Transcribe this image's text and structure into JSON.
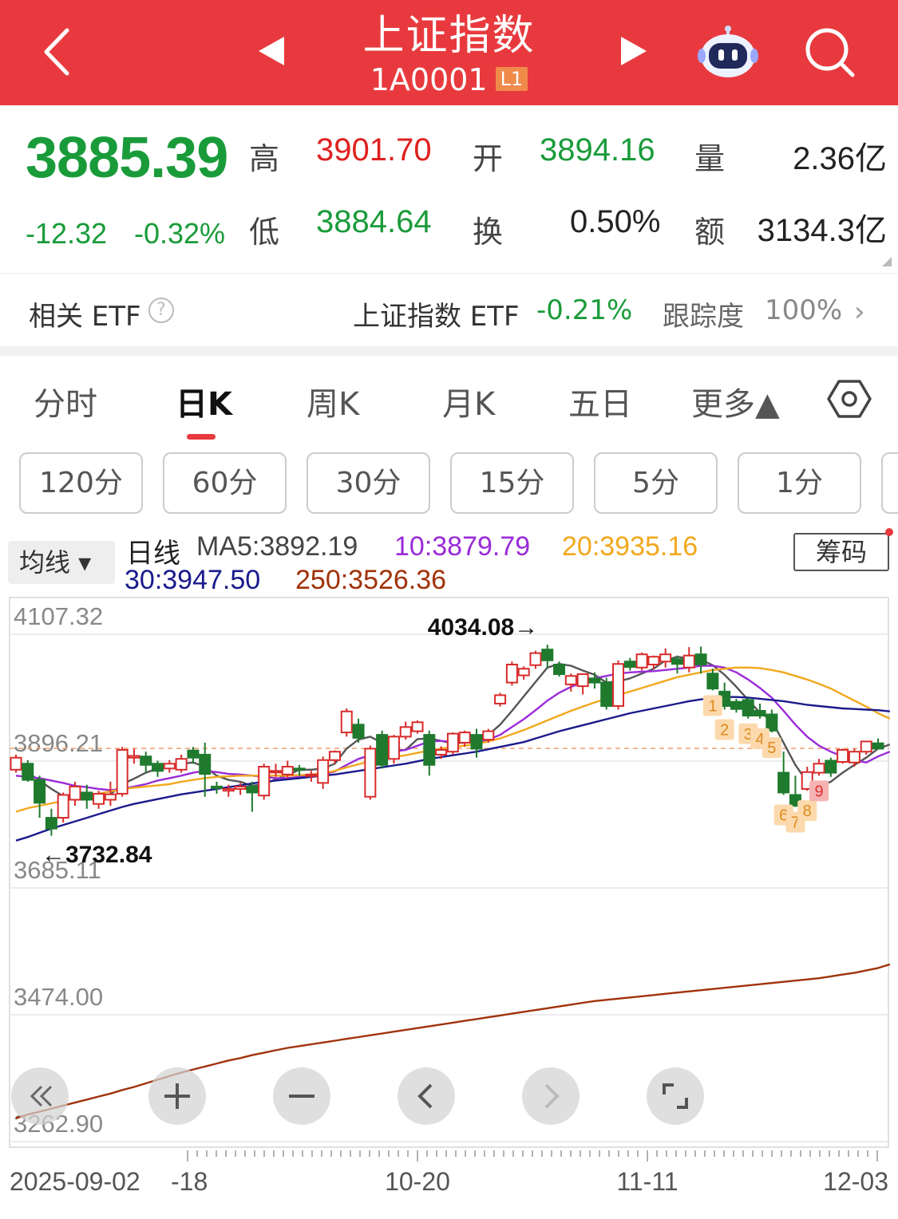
{
  "header": {
    "title": "上证指数",
    "code": "1A0001",
    "badge": "L1",
    "icons": [
      "back-arrow-icon",
      "prev-stock-icon",
      "next-stock-icon",
      "robot-assistant-icon",
      "search-icon"
    ]
  },
  "quote": {
    "price": "3885.39",
    "change": "-12.32",
    "change_pct": "-0.32%",
    "high_label": "高",
    "high": "3901.70",
    "open_label": "开",
    "open": "3894.16",
    "volume_label": "量",
    "volume": "2.36亿",
    "low_label": "低",
    "low": "3884.64",
    "turnover_label": "换",
    "turnover": "0.50%",
    "amount_label": "额",
    "amount": "3134.3亿",
    "colors": {
      "up": "#e02020",
      "down": "#1a9b3a"
    }
  },
  "etf": {
    "label": "相关 ETF",
    "help": "?",
    "name": "上证指数 ETF",
    "pct": "-0.21%",
    "track_label": "跟踪度",
    "track_value": "100%",
    "arrow": "›"
  },
  "tabs": {
    "items": [
      "分时",
      "日K",
      "周K",
      "月K",
      "五日",
      "更多▲"
    ],
    "active": "日K"
  },
  "periods": [
    "120分",
    "60分",
    "30分",
    "15分",
    "5分",
    "1分"
  ],
  "chart_header": {
    "ma_button": "均线 ▾",
    "line_label": "日线",
    "ma5": "MA5:3892.19",
    "ma10": "10:3879.79",
    "ma20": "20:3935.16",
    "ma30": "30:3947.50",
    "ma250": "250:3526.36",
    "chip_button": "筹码"
  },
  "chart_data": {
    "type": "candlestick",
    "y_ticks": [
      "4107.32",
      "3896.21",
      "3685.11",
      "3474.00",
      "3262.90"
    ],
    "ylim": [
      3262.9,
      4107.32
    ],
    "x_ticks": [
      "2025-09-02",
      "-18",
      "10-20",
      "11-11",
      "12-03"
    ],
    "annotations": {
      "max": "4034.08→",
      "min": "←3732.84"
    },
    "reference_price": 3885.39,
    "candles": [
      [
        3850,
        3870,
        3845,
        3875
      ],
      [
        3860,
        3833,
        3830,
        3866
      ],
      [
        3833,
        3795,
        3770,
        3840
      ],
      [
        3770,
        3752,
        3740,
        3785
      ],
      [
        3770,
        3808,
        3762,
        3812
      ],
      [
        3800,
        3822,
        3790,
        3830
      ],
      [
        3812,
        3800,
        3785,
        3825
      ],
      [
        3793,
        3810,
        3785,
        3815
      ],
      [
        3800,
        3809,
        3790,
        3830
      ],
      [
        3810,
        3883,
        3805,
        3888
      ],
      [
        3870,
        3873,
        3860,
        3885
      ],
      [
        3872,
        3858,
        3845,
        3880
      ],
      [
        3860,
        3848,
        3838,
        3865
      ],
      [
        3852,
        3860,
        3845,
        3866
      ],
      [
        3850,
        3868,
        3845,
        3875
      ],
      [
        3882,
        3870,
        3860,
        3888
      ],
      [
        3875,
        3843,
        3805,
        3895
      ],
      [
        3822,
        3820,
        3810,
        3830
      ],
      [
        3815,
        3818,
        3805,
        3825
      ],
      [
        3818,
        3822,
        3808,
        3828
      ],
      [
        3822,
        3812,
        3780,
        3830
      ],
      [
        3807,
        3855,
        3800,
        3860
      ],
      [
        3847,
        3848,
        3838,
        3860
      ],
      [
        3842,
        3855,
        3835,
        3865
      ],
      [
        3852,
        3850,
        3840,
        3858
      ],
      [
        3842,
        3842,
        3830,
        3848
      ],
      [
        3828,
        3866,
        3818,
        3872
      ],
      [
        3866,
        3880,
        3860,
        3882
      ],
      [
        3912,
        3947,
        3905,
        3952
      ],
      [
        3925,
        3903,
        3895,
        3935
      ],
      [
        3805,
        3885,
        3800,
        3890
      ],
      [
        3908,
        3858,
        3852,
        3915
      ],
      [
        3868,
        3905,
        3860,
        3908
      ],
      [
        3905,
        3921,
        3900,
        3930
      ],
      [
        3914,
        3929,
        3910,
        3932
      ],
      [
        3908,
        3858,
        3840,
        3915
      ],
      [
        3875,
        3883,
        3868,
        3889
      ],
      [
        3880,
        3910,
        3875,
        3912
      ],
      [
        3895,
        3912,
        3888,
        3915
      ],
      [
        3908,
        3885,
        3870,
        3918
      ],
      [
        3900,
        3914,
        3895,
        3918
      ],
      [
        3960,
        3974,
        3955,
        3978
      ],
      [
        3995,
        4025,
        3990,
        4030
      ],
      [
        4007,
        4018,
        4000,
        4022
      ],
      [
        4024,
        4044,
        4018,
        4048
      ],
      [
        4050,
        4032,
        4020,
        4058
      ],
      [
        4025,
        4009,
        4005,
        4030
      ],
      [
        3992,
        4006,
        3980,
        4010
      ],
      [
        3989,
        4009,
        3975,
        4010
      ],
      [
        4002,
        3995,
        3985,
        4012
      ],
      [
        3995,
        3956,
        3950,
        4003
      ],
      [
        3956,
        4026,
        3950,
        4032
      ],
      [
        4030,
        4021,
        4015,
        4036
      ],
      [
        4020,
        4042,
        4015,
        4045
      ],
      [
        4025,
        4038,
        4018,
        4040
      ],
      [
        4030,
        4042,
        4020,
        4052
      ],
      [
        4034,
        4026,
        4010,
        4040
      ],
      [
        4020,
        4040,
        4012,
        4054
      ],
      [
        4042,
        4025,
        4010,
        4055
      ],
      [
        4010,
        3985,
        3982,
        4018
      ],
      [
        3980,
        3956,
        3950,
        3995
      ],
      [
        3963,
        3951,
        3945,
        3968
      ],
      [
        3966,
        3940,
        3935,
        3970
      ],
      [
        3948,
        3940,
        3935,
        3960
      ],
      [
        3942,
        3915,
        3912,
        3950
      ],
      [
        3845,
        3812,
        3808,
        3880
      ],
      [
        3808,
        3790,
        3788,
        3840
      ],
      [
        3818,
        3846,
        3815,
        3855
      ],
      [
        3845,
        3860,
        3840,
        3868
      ],
      [
        3865,
        3845,
        3838,
        3870
      ],
      [
        3863,
        3883,
        3860,
        3885
      ],
      [
        3862,
        3880,
        3855,
        3885
      ],
      [
        3880,
        3897,
        3875,
        3898
      ],
      [
        3894,
        3885,
        3884,
        3902
      ]
    ],
    "ma_series": [
      {
        "name": "MA5",
        "color": "#555555",
        "values": [
          3856,
          3845,
          3832,
          3818,
          3806,
          3800,
          3805,
          3808,
          3809,
          3826,
          3835,
          3845,
          3852,
          3857,
          3860,
          3862,
          3855,
          3840,
          3833,
          3830,
          3823,
          3826,
          3834,
          3841,
          3850,
          3850,
          3852,
          3860,
          3885,
          3900,
          3905,
          3895,
          3882,
          3883,
          3901,
          3902,
          3898,
          3894,
          3895,
          3902,
          3908,
          3925,
          3948,
          3972,
          3996,
          4020,
          4026,
          4023,
          4015,
          4008,
          3995,
          3997,
          4002,
          4010,
          4018,
          4032,
          4038,
          4035,
          4033,
          4024,
          4008,
          3988,
          3966,
          3945,
          3932,
          3895,
          3858,
          3830,
          3822,
          3830,
          3845,
          3858,
          3870,
          3885,
          3892
        ]
      },
      {
        "name": "MA10",
        "color": "#9a2bd8",
        "values": [
          3840,
          3838,
          3836,
          3832,
          3828,
          3823,
          3821,
          3818,
          3816,
          3818,
          3822,
          3826,
          3832,
          3836,
          3840,
          3845,
          3848,
          3846,
          3843,
          3842,
          3840,
          3838,
          3836,
          3836,
          3838,
          3840,
          3842,
          3847,
          3858,
          3868,
          3874,
          3878,
          3880,
          3883,
          3890,
          3897,
          3898,
          3896,
          3895,
          3896,
          3900,
          3908,
          3921,
          3934,
          3949,
          3965,
          3978,
          3988,
          3995,
          4002,
          4006,
          4010,
          4012,
          4013,
          4014,
          4016,
          4018,
          4020,
          4023,
          4023,
          4020,
          4012,
          4000,
          3986,
          3970,
          3948,
          3925,
          3905,
          3890,
          3880,
          3872,
          3866,
          3862,
          3872,
          3880
        ]
      },
      {
        "name": "MA20",
        "color": "#f2a81d",
        "values": [
          3780,
          3786,
          3790,
          3794,
          3798,
          3802,
          3806,
          3810,
          3814,
          3818,
          3820,
          3822,
          3824,
          3826,
          3830,
          3833,
          3836,
          3838,
          3839,
          3840,
          3840,
          3840,
          3840,
          3840,
          3841,
          3842,
          3844,
          3848,
          3854,
          3859,
          3864,
          3868,
          3871,
          3874,
          3878,
          3882,
          3885,
          3888,
          3890,
          3893,
          3897,
          3902,
          3909,
          3916,
          3924,
          3932,
          3940,
          3948,
          3955,
          3962,
          3968,
          3974,
          3980,
          3986,
          3992,
          3998,
          4004,
          4008,
          4012,
          4016,
          4018,
          4020,
          4020,
          4019,
          4016,
          4012,
          4006,
          4000,
          3993,
          3985,
          3975,
          3965,
          3955,
          3944,
          3935
        ]
      },
      {
        "name": "MA30",
        "color": "#1a1a8c",
        "values": [
          3732,
          3738,
          3745,
          3752,
          3758,
          3764,
          3770,
          3776,
          3782,
          3788,
          3793,
          3797,
          3801,
          3805,
          3809,
          3812,
          3815,
          3818,
          3821,
          3824,
          3827,
          3830,
          3832,
          3834,
          3836,
          3838,
          3840,
          3842,
          3845,
          3848,
          3851,
          3854,
          3857,
          3860,
          3864,
          3868,
          3871,
          3874,
          3877,
          3880,
          3884,
          3888,
          3892,
          3896,
          3902,
          3908,
          3914,
          3919,
          3924,
          3929,
          3934,
          3939,
          3944,
          3948,
          3952,
          3956,
          3960,
          3964,
          3967,
          3970,
          3971,
          3971,
          3970,
          3968,
          3966,
          3964,
          3961,
          3958,
          3956,
          3954,
          3952,
          3951,
          3950,
          3949,
          3947
        ]
      },
      {
        "name": "MA250",
        "color": "#a0320a",
        "values": [
          3270,
          3276,
          3281,
          3286,
          3291,
          3296,
          3301,
          3306,
          3311,
          3317,
          3322,
          3328,
          3334,
          3340,
          3346,
          3351,
          3356,
          3361,
          3366,
          3370,
          3375,
          3379,
          3383,
          3387,
          3390,
          3393,
          3396,
          3399,
          3402,
          3405,
          3408,
          3411,
          3414,
          3417,
          3420,
          3423,
          3426,
          3429,
          3432,
          3435,
          3438,
          3441,
          3444,
          3447,
          3450,
          3453,
          3456,
          3459,
          3462,
          3465,
          3467,
          3469,
          3471,
          3473,
          3475,
          3477,
          3479,
          3481,
          3483,
          3485,
          3487,
          3489,
          3491,
          3493,
          3495,
          3497,
          3499,
          3501,
          3503,
          3506,
          3509,
          3512,
          3516,
          3520,
          3526
        ]
      }
    ],
    "td_markers": [
      {
        "i": 59,
        "label": "1"
      },
      {
        "i": 60,
        "label": "2"
      },
      {
        "i": 62,
        "label": "3"
      },
      {
        "i": 63,
        "label": "4"
      },
      {
        "i": 64,
        "label": "5"
      },
      {
        "i": 65,
        "label": "6"
      },
      {
        "i": 66,
        "label": "7"
      },
      {
        "i": 67,
        "label": "8"
      },
      {
        "i": 68,
        "label": "9"
      }
    ]
  }
}
